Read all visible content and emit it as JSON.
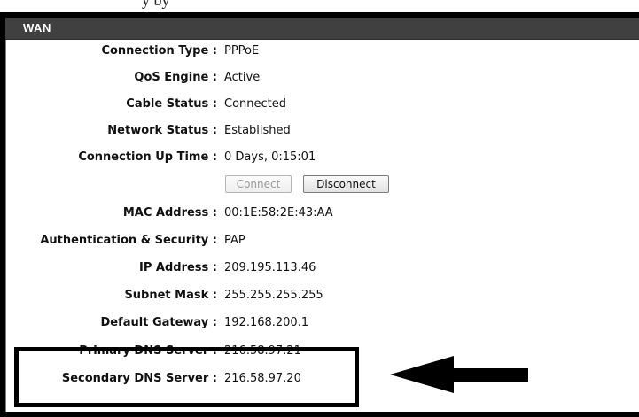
{
  "header_cut_text": "y   by",
  "panel": {
    "title": "WAN"
  },
  "rows": [
    {
      "label": "Connection Type :",
      "value": "PPPoE"
    },
    {
      "label": "QoS Engine :",
      "value": "Active"
    },
    {
      "label": "Cable Status :",
      "value": "Connected"
    },
    {
      "label": "Network Status :",
      "value": "Established"
    },
    {
      "label": "Connection Up Time :",
      "value": "0 Days, 0:15:01"
    },
    {
      "label": "MAC Address :",
      "value": "00:1E:58:2E:43:AA"
    },
    {
      "label": "Authentication & Security :",
      "value": "PAP"
    },
    {
      "label": "IP Address :",
      "value": "209.195.113.46"
    },
    {
      "label": "Subnet Mask :",
      "value": "255.255.255.255"
    },
    {
      "label": "Default Gateway :",
      "value": "192.168.200.1"
    },
    {
      "label": "Primary DNS Server :",
      "value": "216.58.97.21"
    },
    {
      "label": "Secondary DNS Server :",
      "value": "216.58.97.20"
    }
  ],
  "buttons": {
    "connect_label": "Connect",
    "disconnect_label": "Disconnect"
  },
  "colors": {
    "header_bg": "#404040",
    "frame": "#000000",
    "text": "#111111"
  },
  "icons": {
    "arrow": "arrow-left-icon"
  }
}
